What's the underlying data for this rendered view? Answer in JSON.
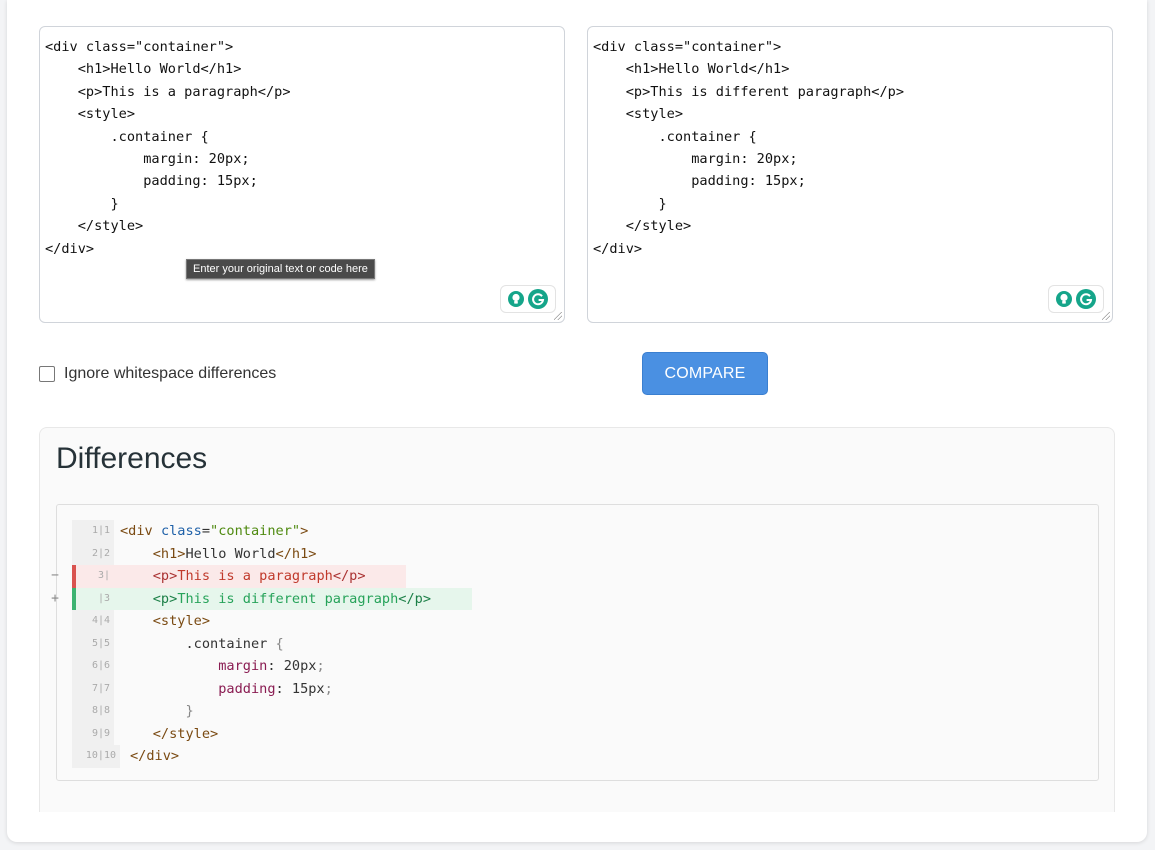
{
  "left_editor": {
    "text": "<div class=\"container\">\n    <h1>Hello World</h1>\n    <p>This is a paragraph</p>\n    <style>\n        .container {\n            margin: 20px;\n            padding: 15px;\n        }\n    </style>\n</div>",
    "tooltip": "Enter your original text or code here"
  },
  "right_editor": {
    "text": "<div class=\"container\">\n    <h1>Hello World</h1>\n    <p>This is different paragraph</p>\n    <style>\n        .container {\n            margin: 20px;\n            padding: 15px;\n        }\n    </style>\n</div>"
  },
  "options": {
    "ignore_whitespace_label": "Ignore whitespace differences",
    "ignore_whitespace_checked": false
  },
  "compare_button": "COMPARE",
  "differences": {
    "title": "Differences",
    "lines": [
      {
        "type": "same",
        "gutter": "1|1",
        "code": "<div class=\"container\">"
      },
      {
        "type": "same",
        "gutter": "2|2",
        "code": "    <h1>Hello World</h1>"
      },
      {
        "type": "del",
        "mark": "−",
        "gutter": "3|",
        "code": "    <p>This is a paragraph</p>"
      },
      {
        "type": "add",
        "mark": "+",
        "gutter": "|3",
        "code": "    <p>This is different paragraph</p>"
      },
      {
        "type": "same",
        "gutter": "4|4",
        "code": "    <style>"
      },
      {
        "type": "same",
        "gutter": "5|5",
        "code": "        .container {"
      },
      {
        "type": "same",
        "gutter": "6|6",
        "code": "            margin: 20px;"
      },
      {
        "type": "same",
        "gutter": "7|7",
        "code": "            padding: 15px;"
      },
      {
        "type": "same",
        "gutter": "8|8",
        "code": "        }"
      },
      {
        "type": "same",
        "gutter": "9|9",
        "code": "    </style>"
      },
      {
        "type": "same",
        "gutter": "10|10",
        "code": "</div>"
      }
    ]
  },
  "colors": {
    "accent": "#4a90e2",
    "deleted": "#d9534f",
    "added": "#3cb371",
    "grammarly": "#15a58a"
  }
}
